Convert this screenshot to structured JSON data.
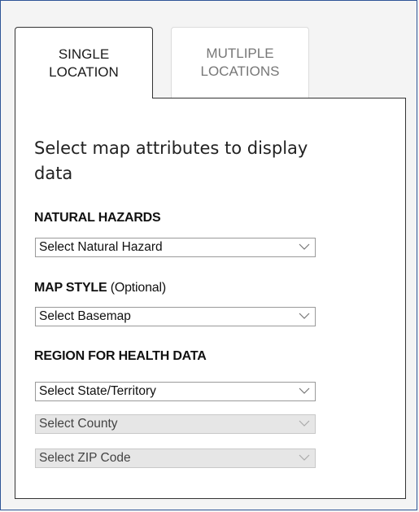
{
  "tabs": [
    {
      "line1": "SINGLE",
      "line2": "LOCATION",
      "active": true
    },
    {
      "line1": "MUTLIPLE",
      "line2": "LOCATIONS",
      "active": false
    }
  ],
  "panel": {
    "heading": "Select map attributes to display data",
    "natural_hazards": {
      "label": "NATURAL HAZARDS",
      "selected": "Select Natural Hazard"
    },
    "map_style": {
      "label": "MAP STYLE",
      "optional": "(Optional)",
      "selected": "Select Basemap"
    },
    "region": {
      "label": "REGION FOR HEALTH DATA",
      "state": "Select State/Territory",
      "county": "Select County",
      "zip": "Select ZIP Code"
    }
  },
  "colors": {
    "frame_border": "#2f5597",
    "disabled_select_bg": "#e6e6e6"
  }
}
